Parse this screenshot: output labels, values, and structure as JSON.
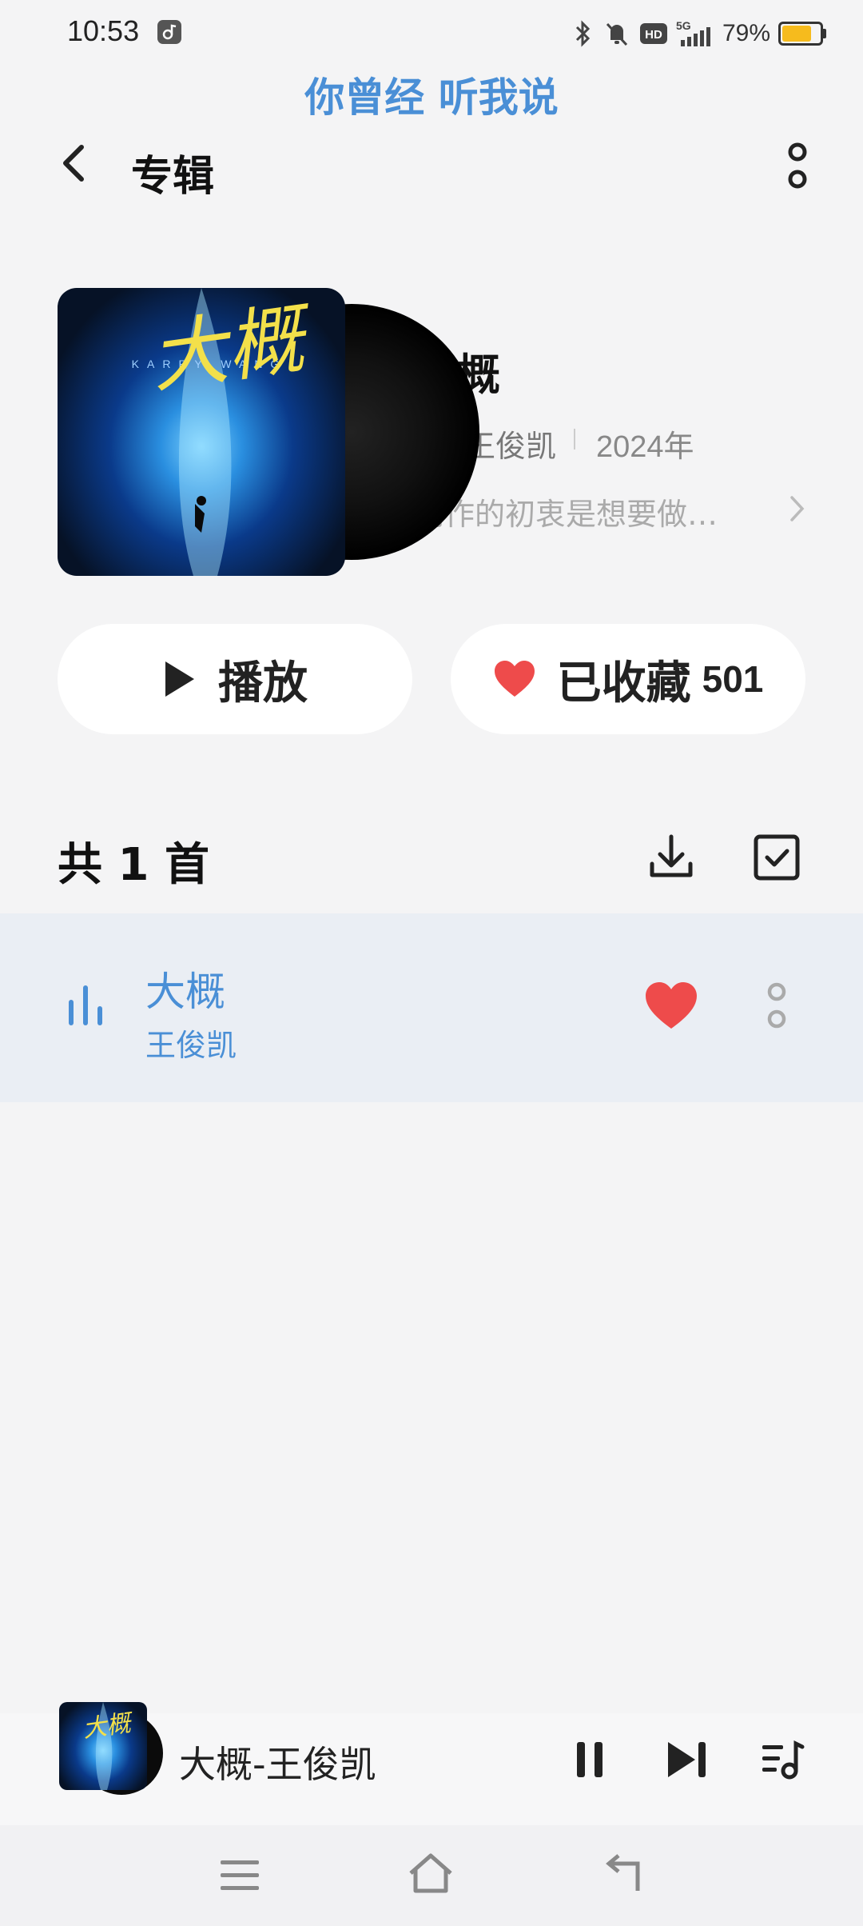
{
  "status_bar": {
    "time": "10:53",
    "battery_percent": "79%",
    "battery_level": 0.79,
    "battery_color": "#f6bb1d",
    "icons": [
      "music-app-icon",
      "bluetooth-icon",
      "mute-icon",
      "hd-icon",
      "5g-signal-icon",
      "battery-icon"
    ]
  },
  "lyric_banner": "你曾经 听我说",
  "header": {
    "title": "专辑"
  },
  "album": {
    "cover_title": "大概",
    "cover_subtitle": "KARRY WANG",
    "name": "大概",
    "artist": "王俊凯",
    "year": "2024年",
    "description": "创作的初衷是想要做…"
  },
  "actions": {
    "play_label": "播放",
    "favorite_label": "已收藏",
    "favorite_count": "501"
  },
  "list": {
    "count_label": "共 1 首",
    "songs": [
      {
        "title": "大概",
        "artist": "王俊凯",
        "favorited": true,
        "playing": true
      }
    ]
  },
  "mini_player": {
    "title": "大概-王俊凯",
    "state": "playing"
  },
  "colors": {
    "accent": "#4a8fd6",
    "heart": "#ee4b4b",
    "background": "#f4f4f5",
    "active_row": "#eaeef4"
  }
}
